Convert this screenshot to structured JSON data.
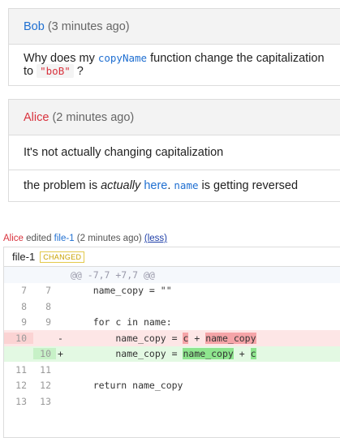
{
  "bob_comment": {
    "author": "Bob",
    "time": "(3 minutes ago)",
    "text_before": "Why does my ",
    "code_fn": "copyName",
    "text_middle": " function change the capitalization to ",
    "code_str": "\"boB\"",
    "text_after": " ?"
  },
  "alice_comment": {
    "author": "Alice",
    "time": "(2 minutes ago)",
    "msg1": "It's not actually changing capitalization",
    "msg2_a": "the problem is ",
    "msg2_em": "actually",
    "msg2_b": " ",
    "msg2_link": "here",
    "msg2_c": ". ",
    "msg2_code": "name",
    "msg2_d": " is getting reversed"
  },
  "edit_event": {
    "author": "Alice",
    "action": " edited ",
    "file": "file-1",
    "time": " (2 minutes ago) ",
    "toggle": "(less)"
  },
  "diff": {
    "file": "file-1",
    "badge": "CHANGED",
    "hunk": "@@ -7,7 +7,7 @@",
    "lines": [
      {
        "old": "7",
        "new": "7",
        "sign": "",
        "code": "    name_copy = \"\""
      },
      {
        "old": "8",
        "new": "8",
        "sign": "",
        "code": ""
      },
      {
        "old": "9",
        "new": "9",
        "sign": "",
        "code": "    for c in name:"
      },
      {
        "old": "10",
        "new": "",
        "sign": "-",
        "pre": "        name_copy = ",
        "h1": "c",
        "mid": " + ",
        "h2": "name_copy"
      },
      {
        "old": "",
        "new": "10",
        "sign": "+",
        "pre": "        name_copy = ",
        "h1": "name_copy",
        "mid": " + ",
        "h2": "c"
      },
      {
        "old": "11",
        "new": "11",
        "sign": "",
        "code": ""
      },
      {
        "old": "12",
        "new": "12",
        "sign": "",
        "code": "    return name_copy"
      },
      {
        "old": "13",
        "new": "13",
        "sign": "",
        "code": ""
      }
    ]
  }
}
